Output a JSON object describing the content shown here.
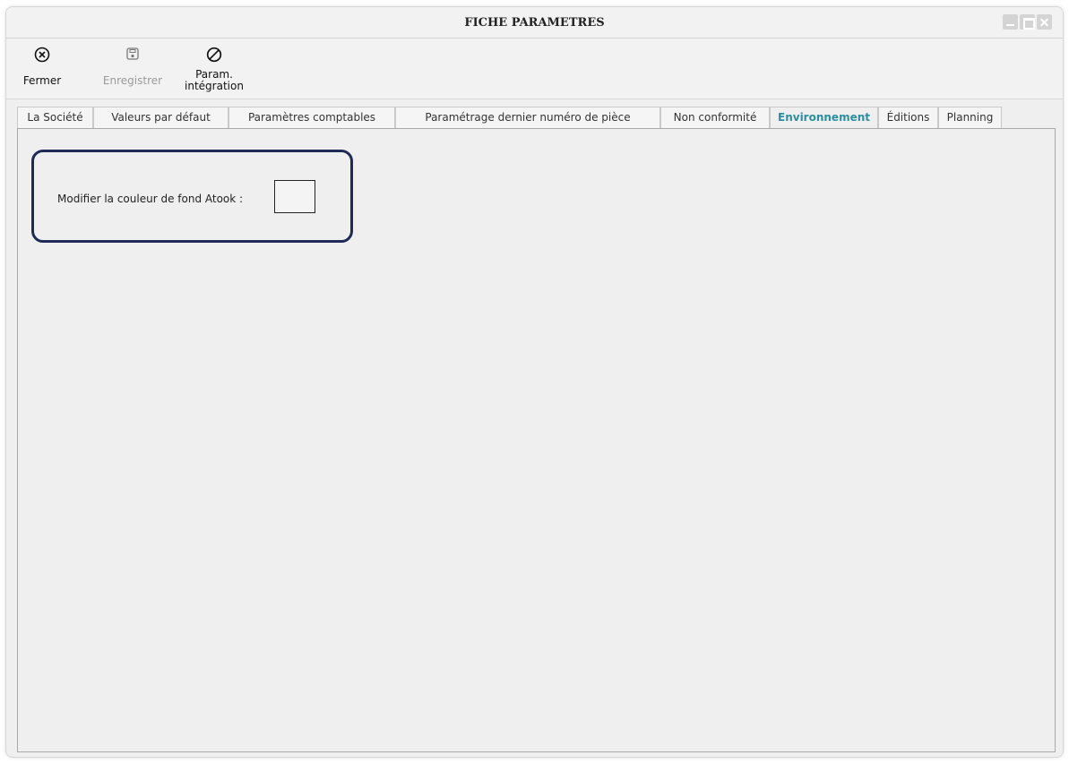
{
  "window": {
    "title": "FICHE PARAMETRES"
  },
  "toolbar": {
    "close_label": "Fermer",
    "save_label": "Enregistrer",
    "integration_label_line1": "Param.",
    "integration_label_line2": "intégration"
  },
  "tabs": [
    {
      "label": "La Société"
    },
    {
      "label": "Valeurs par défaut"
    },
    {
      "label": "Paramètres comptables"
    },
    {
      "label": "Paramétrage dernier numéro de pièce"
    },
    {
      "label": "Non conformité"
    },
    {
      "label": "Environnement",
      "active": true
    },
    {
      "label": "Éditions"
    },
    {
      "label": "Planning"
    }
  ],
  "environment": {
    "bg_color_label": "Modifier la couleur de fond Atook :",
    "bg_color_value": "#f4f4f4"
  },
  "colors": {
    "active_tab": "#2b8ea3",
    "highlight_border": "#1f2a55"
  }
}
